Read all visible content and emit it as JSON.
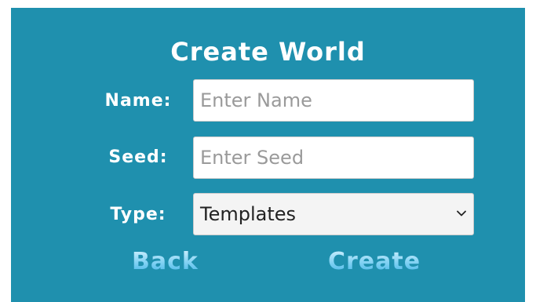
{
  "title": "Create World",
  "form": {
    "name_label": "Name:",
    "name_placeholder": "Enter Name",
    "seed_label": "Seed:",
    "seed_placeholder": "Enter Seed",
    "type_label": "Type:",
    "type_value": "Templates"
  },
  "actions": {
    "back_label": "Back",
    "create_label": "Create"
  },
  "colors": {
    "panel_background": "#1f90ae",
    "button_text_light": "#d8f3ff",
    "button_text_dark": "#3cb2e6"
  },
  "icons": {
    "dropdown": "chevron-down-icon"
  }
}
